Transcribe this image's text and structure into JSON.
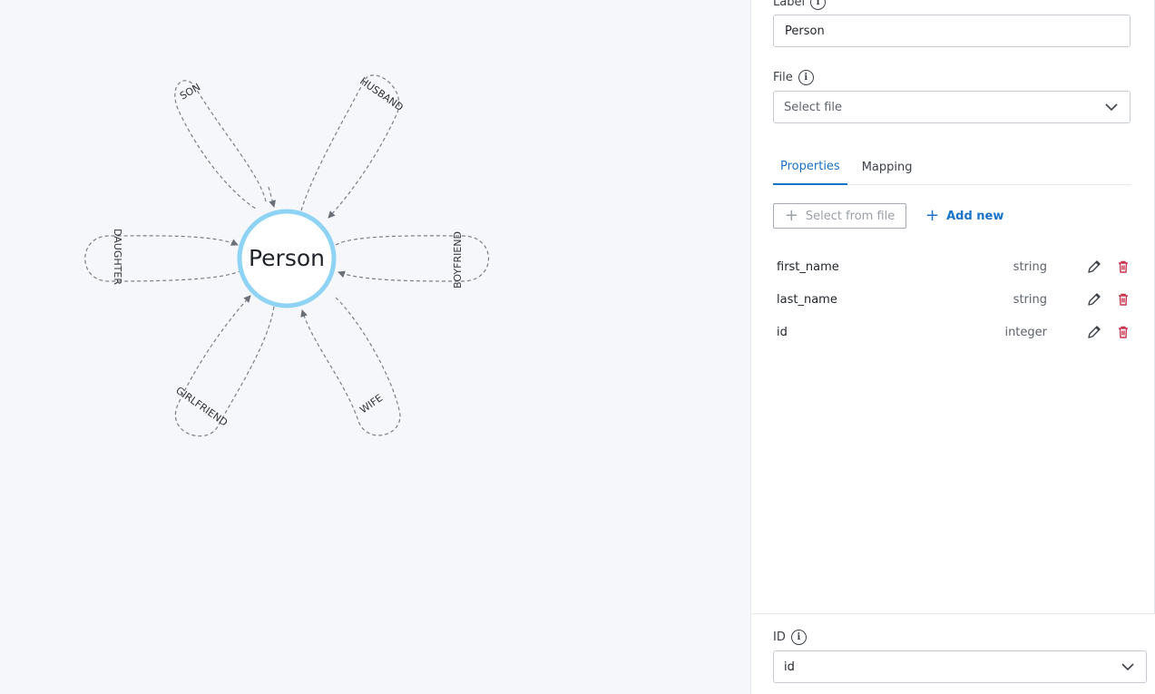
{
  "graph": {
    "node_label": "Person",
    "relationships": [
      "SON",
      "HUSBAND",
      "DAUGHTER",
      "BOYFRIEND",
      "GIRLFRIEND",
      "WIFE"
    ]
  },
  "panel": {
    "label_field": {
      "label": "Label",
      "value": "Person"
    },
    "file_field": {
      "label": "File",
      "placeholder": "Select file"
    },
    "tabs": [
      {
        "label": "Properties",
        "active": true
      },
      {
        "label": "Mapping",
        "active": false
      }
    ],
    "select_from_file_label": "Select from file",
    "add_new_label": "Add new",
    "properties": [
      {
        "name": "first_name",
        "type": "string"
      },
      {
        "name": "last_name",
        "type": "string"
      },
      {
        "name": "id",
        "type": "integer"
      }
    ],
    "id_field": {
      "label": "ID",
      "value": "id"
    }
  },
  "colors": {
    "accent": "#1a73c6",
    "node_ring": "#8fd3f4",
    "delete": "#c8354f"
  }
}
